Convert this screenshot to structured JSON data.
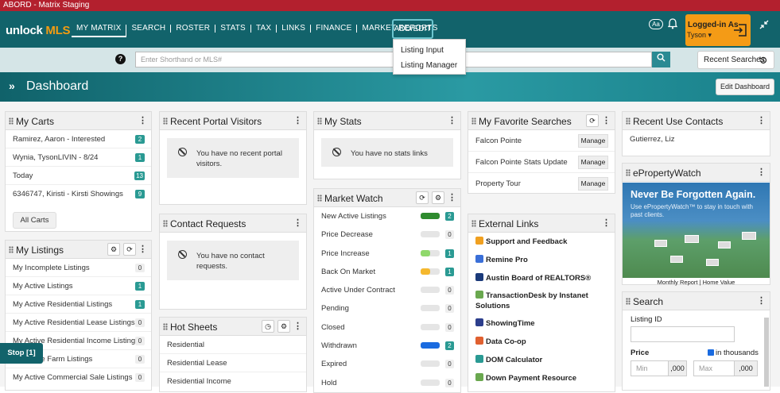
{
  "window": {
    "title": "ABORD - Matrix Staging"
  },
  "logo": {
    "part1": "unlock ",
    "part2": "MLS"
  },
  "nav": {
    "items": [
      "MY MATRIX",
      "SEARCH",
      "ROSTER",
      "STATS",
      "TAX",
      "LINKS",
      "FINANCE",
      "MARKET REPORTS"
    ],
    "add_edit": "ADD/EDIT"
  },
  "dropdown": {
    "items": [
      "Listing Input",
      "Listing Manager"
    ]
  },
  "header_right": {
    "aa": "Aa",
    "login_label": "Logged-in As",
    "user": "Tyson"
  },
  "search": {
    "placeholder": "Enter Shorthand or MLS#",
    "recent_label": "Recent Searches"
  },
  "dashboard": {
    "title": "Dashboard",
    "edit_label": "Edit Dashboard"
  },
  "carts": {
    "title": "My Carts",
    "items": [
      {
        "label": "Ramirez, Aaron - Interested",
        "count": "2"
      },
      {
        "label": "Wynia, TysonLIVIN - 8/24",
        "count": "1"
      },
      {
        "label": "Today",
        "count": "13"
      },
      {
        "label": "6346747, Kiristi - Kirsti Showings",
        "count": "9"
      }
    ],
    "all_label": "All Carts"
  },
  "listings": {
    "title": "My Listings",
    "items": [
      {
        "label": "My Incomplete Listings",
        "count": "0"
      },
      {
        "label": "My Active Listings",
        "count": "1"
      },
      {
        "label": "My Active Residential Listings",
        "count": "1"
      },
      {
        "label": "My Active Residential Lease Listings",
        "count": "0"
      },
      {
        "label": "My Active Residential Income Listings",
        "count": "0"
      },
      {
        "label": "My Active Farm Listings",
        "count": "0"
      },
      {
        "label": "My Active Commercial Sale Listings",
        "count": "0"
      }
    ]
  },
  "portal": {
    "title": "Recent Portal Visitors",
    "empty": "You have no recent portal visitors."
  },
  "contact_requests": {
    "title": "Contact Requests",
    "empty": "You have no contact requests."
  },
  "hotsheets": {
    "title": "Hot Sheets",
    "items": [
      "Residential",
      "Residential Lease",
      "Residential Income"
    ]
  },
  "stats": {
    "title": "My Stats",
    "empty": "You have no stats links"
  },
  "market_watch": {
    "title": "Market Watch",
    "items": [
      {
        "label": "New Active Listings",
        "count": "2",
        "fill": 1.0,
        "color": "#2e8b2e"
      },
      {
        "label": "Price Decrease",
        "count": "0",
        "fill": 0,
        "color": "#e5e5e5"
      },
      {
        "label": "Price Increase",
        "count": "1",
        "fill": 0.5,
        "color": "#8fd86b"
      },
      {
        "label": "Back On Market",
        "count": "1",
        "fill": 0.5,
        "color": "#f5b82e"
      },
      {
        "label": "Active Under Contract",
        "count": "0",
        "fill": 0,
        "color": "#e5e5e5"
      },
      {
        "label": "Pending",
        "count": "0",
        "fill": 0,
        "color": "#e5e5e5"
      },
      {
        "label": "Closed",
        "count": "0",
        "fill": 0,
        "color": "#e5e5e5"
      },
      {
        "label": "Withdrawn",
        "count": "2",
        "fill": 1.0,
        "color": "#1a6be0"
      },
      {
        "label": "Expired",
        "count": "0",
        "fill": 0,
        "color": "#e5e5e5"
      },
      {
        "label": "Hold",
        "count": "0",
        "fill": 0,
        "color": "#e5e5e5"
      }
    ]
  },
  "favorites": {
    "title": "My Favorite Searches",
    "manage_label": "Manage",
    "items": [
      "Falcon Pointe",
      "Falcon Pointe Stats Update",
      "Property Tour"
    ]
  },
  "ext_links": {
    "title": "External Links",
    "items": [
      {
        "label": "Support and Feedback",
        "color": "#f0a020"
      },
      {
        "label": "Remine Pro",
        "color": "#3a6fd8"
      },
      {
        "label": "Austin Board of REALTORS®",
        "color": "#1b3a7a"
      },
      {
        "label": "TransactionDesk by Instanet Solutions",
        "color": "#6aa84f"
      },
      {
        "label": "ShowingTime",
        "color": "#2c3e8c"
      },
      {
        "label": "Data Co-op",
        "color": "#e06030"
      },
      {
        "label": "DOM Calculator",
        "color": "#2a9a93"
      },
      {
        "label": "Down Payment Resource",
        "color": "#6aa84f"
      }
    ]
  },
  "contacts": {
    "title": "Recent Use Contacts",
    "items": [
      "Gutierrez, Liz"
    ]
  },
  "epw": {
    "title": "ePropertyWatch",
    "headline": "Never Be Forgotten Again.",
    "sub": "Use ePropertyWatch™ to stay in touch with past clients.",
    "caption": "Monthly Report | Home Value"
  },
  "searchw": {
    "title": "Search",
    "listing_id": "Listing ID",
    "price": "Price",
    "thousands": "in thousands",
    "min": "Min",
    "max": "Max",
    "suffix": ",000"
  },
  "stop": {
    "label": "Stop [1]"
  }
}
